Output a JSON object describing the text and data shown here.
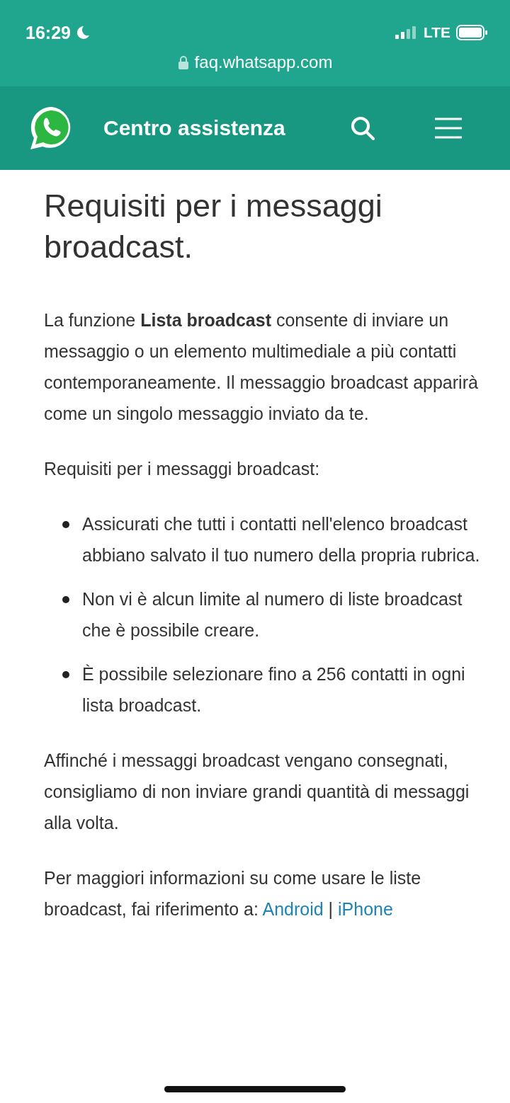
{
  "status_bar": {
    "time": "16:29",
    "network": "LTE"
  },
  "address_bar": {
    "url": "faq.whatsapp.com"
  },
  "header": {
    "title": "Centro assistenza"
  },
  "article": {
    "title": "Requisiti per i messaggi broadcast.",
    "blocks": [
      {
        "kind": "paragraph",
        "text": "La funzione **Lista broadcast** consente di inviare un messaggio o un elemento multimediale a più contatti contemporaneamente. Il messaggio broadcast apparirà come un singolo messaggio inviato da te."
      },
      {
        "kind": "paragraph",
        "text": "Requisiti per i messaggi broadcast:"
      },
      {
        "kind": "list",
        "items": [
          "Assicurati che tutti i contatti nell'elenco broadcast abbiano salvato il tuo numero della propria rubrica.",
          "Non vi è alcun limite al numero di liste broadcast che è possibile creare.",
          "È possibile selezionare fino a 256 contatti in ogni lista broadcast."
        ]
      },
      {
        "kind": "paragraph",
        "text": "Affinché i messaggi broadcast vengano consegnati, consigliamo di non inviare grandi quantità di messaggi alla volta."
      },
      {
        "kind": "links",
        "text": "Per maggiori informazioni su come usare le liste broadcast, fai riferimento a:",
        "separator": "|",
        "links": [
          "Android",
          "iPhone"
        ]
      }
    ]
  }
}
